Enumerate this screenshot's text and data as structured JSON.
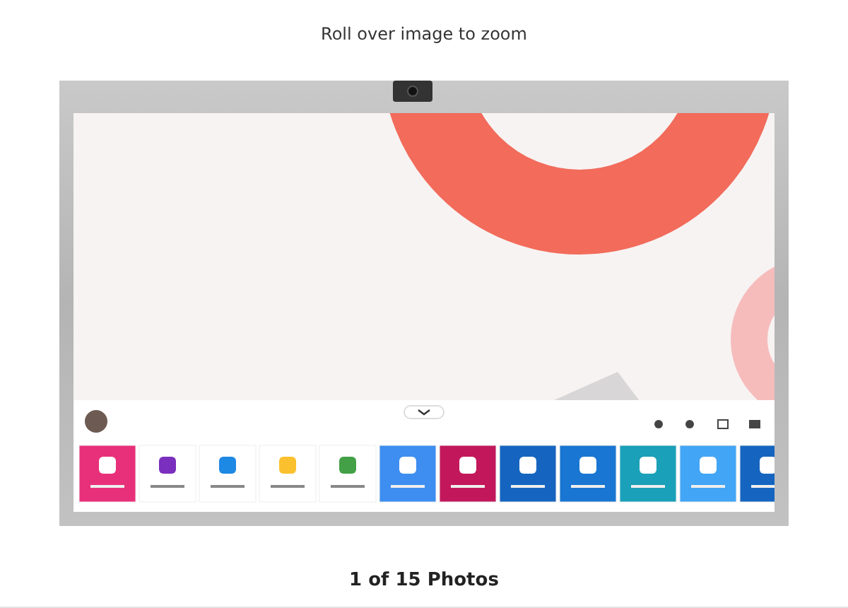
{
  "gallery": {
    "hint": "Roll over image to zoom",
    "counter": "1 of 15 Photos"
  }
}
